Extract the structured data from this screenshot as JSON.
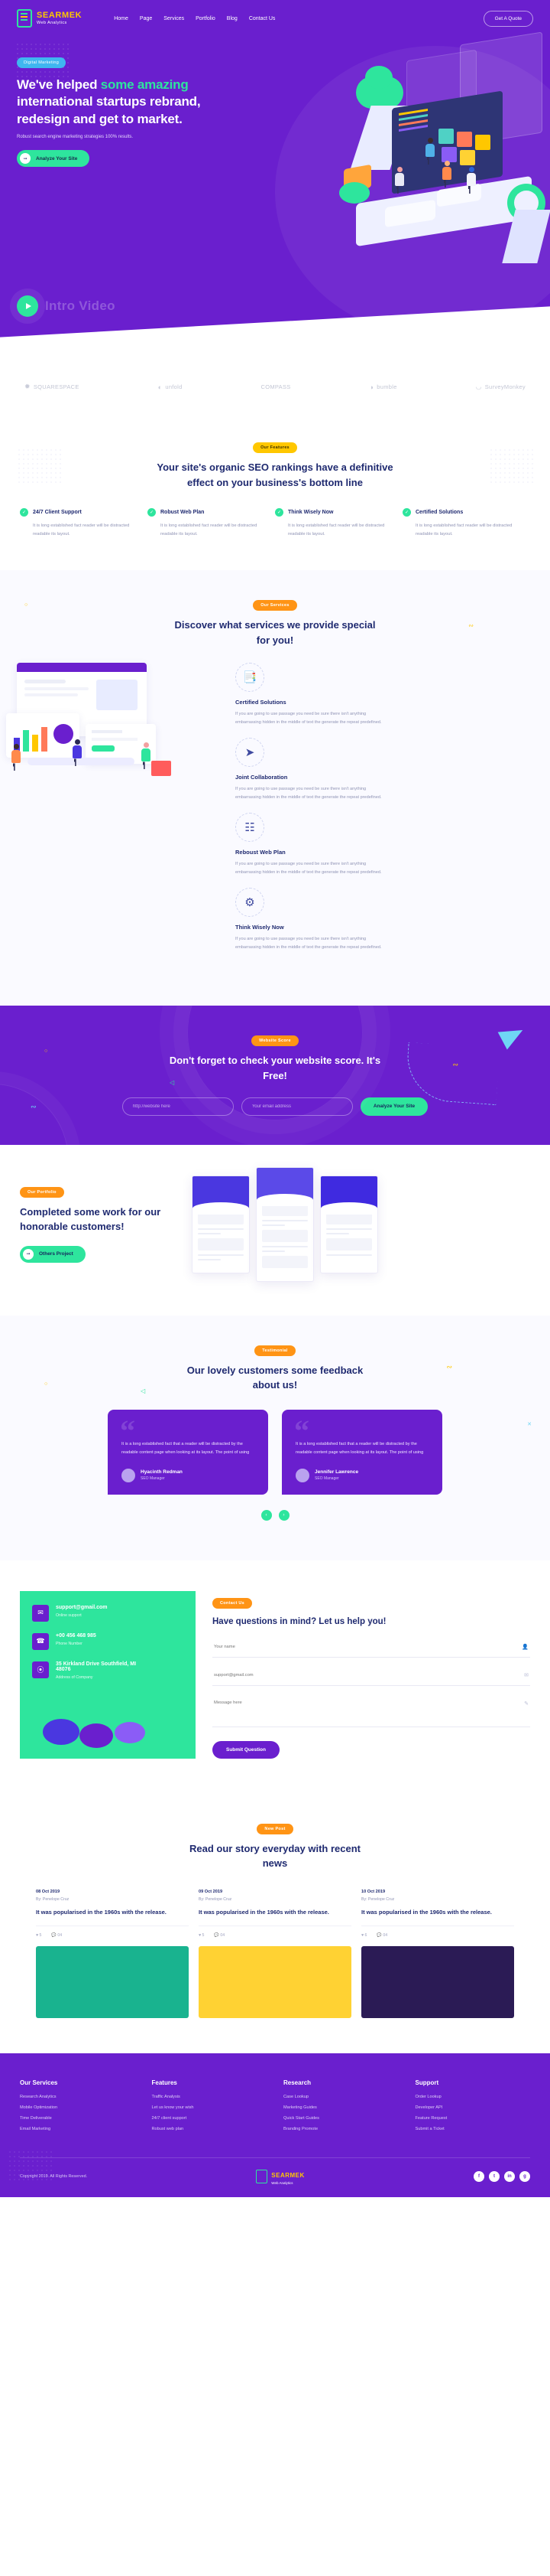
{
  "brand": {
    "name": "SEARMEK",
    "tagline": "Web Analytics"
  },
  "nav": {
    "items": [
      "Home",
      "Page",
      "Services",
      "Portfolio",
      "Blog",
      "Contact Us"
    ],
    "cta": "Get A Quote"
  },
  "hero": {
    "badge": "Digital Marketing",
    "title_part1": "We've helped ",
    "title_accent": "some amazing",
    "title_part2": "international startups rebrand, redesign and get to market.",
    "subtitle": "Robust search engine marketing strategies 100% results.",
    "button": "Analyze Your Site",
    "video_label": "Intro Video"
  },
  "logos": [
    {
      "name": "SQUARESPACE",
      "glyph": "✹"
    },
    {
      "name": "unfold",
      "glyph": "◠"
    },
    {
      "name": "COMPASS",
      "glyph": ""
    },
    {
      "name": "bumble",
      "glyph": "◑"
    },
    {
      "name": "SurveyMonkey",
      "glyph": "◡"
    }
  ],
  "features": {
    "badge": "Our Features",
    "title": "Your site's organic SEO rankings have a definitive effect on your business's bottom line",
    "items": [
      {
        "title": "24/7 Client Support",
        "desc": "It is long established fact reader will be distracted readable its layout."
      },
      {
        "title": "Robust Web Plan",
        "desc": "It is long established fact reader will be distracted readable its layout."
      },
      {
        "title": "Think Wisely Now",
        "desc": "It is long established fact reader will be distracted readable its layout."
      },
      {
        "title": "Certified Solutions",
        "desc": "It is long established fact reader will be distracted readable its layout."
      }
    ]
  },
  "services": {
    "badge": "Our Services",
    "title": "Discover what services we provide special for you!",
    "items": [
      {
        "title": "Certified Solutions",
        "icon": "certificate-icon",
        "glyph": "ὍC",
        "desc": "If you are going to use passage you need be sure there isn't anything embarrassing hidden in the middle of text the generate the repeat predefined."
      },
      {
        "title": "Joint Collaboration",
        "icon": "paper-plane-icon",
        "glyph": "➤",
        "desc": "If you are going to use passage you need be sure there isn't anything embarrassing hidden in the middle of text the generate the repeat predefined."
      },
      {
        "title": "Reboust Web Plan",
        "icon": "web-plan-icon",
        "glyph": "◳",
        "desc": "If you are going to use passage you need be sure there isn't anything embarrassing hidden in the middle of text the generate the repeat predefined."
      },
      {
        "title": "Think Wisely Now",
        "icon": "lightbulb-icon",
        "glyph": "⚙",
        "desc": "If you are going to use passage you need be sure there isn't anything embarrassing hidden in the middle of text the generate the repeat predefined."
      }
    ]
  },
  "cta": {
    "badge": "Website Score",
    "title": "Don't forget to check your website score. It's Free!",
    "website_placeholder": "http://website here",
    "email_placeholder": "Your email address",
    "button": "Analyze Your Site"
  },
  "portfolio": {
    "badge": "Our Portfolio",
    "title": "Completed some work for our honorable customers!",
    "button": "Others Project"
  },
  "testimonials": {
    "badge": "Testimonial",
    "title": "Our lovely customers some feedback about us!",
    "items": [
      {
        "quote": "It is a long established fact that a reader will be distracted by the readable content page when looking at its layout. The point of using",
        "name": "Hyacinth Redman",
        "role": "SEO Manager"
      },
      {
        "quote": "It is a long established fact that a reader will be distracted by the readable content page when looking at its layout. The point of using",
        "name": "Jennifer Lawrence",
        "role": "SEO Manager"
      }
    ],
    "prev": "‹",
    "next": "›"
  },
  "contact": {
    "badge": "Contact Us",
    "title": "Have questions in mind? Let us help you!",
    "info": [
      {
        "icon": "envelope-icon",
        "glyph": "✉",
        "title": "support@gmail.com",
        "sub": "Online support"
      },
      {
        "icon": "phone-icon",
        "glyph": "☎",
        "title": "+00 456 468 985",
        "sub": "Phone Number"
      },
      {
        "icon": "location-icon",
        "glyph": "⦿",
        "title": "35 Kirkland Drive Southfield, MI 48076",
        "sub": "Address of Company"
      }
    ],
    "form": {
      "name_placeholder": "Your name",
      "email_placeholder": "support@gmail.com",
      "message_placeholder": "Message here",
      "submit": "Submit Question"
    }
  },
  "blog": {
    "badge": "New Post",
    "title": "Read our story everyday with recent news",
    "posts": [
      {
        "date": "08 Oct 2019",
        "author": "By: Penelope Cruz",
        "title": "It was popularised in the 1960s with the release.",
        "likes": "5",
        "comments": "04"
      },
      {
        "date": "09 Oct 2019",
        "author": "By: Penelope Cruz",
        "title": "It was popularised in the 1960s with the release.",
        "likes": "5",
        "comments": "04"
      },
      {
        "date": "10 Oct 2019",
        "author": "By: Penelope Cruz",
        "title": "It was popularised in the 1960s with the release.",
        "likes": "6",
        "comments": "04"
      }
    ]
  },
  "footer": {
    "columns": [
      {
        "heading": "Our Services",
        "links": [
          "Research Analytics",
          "Mobile Optimization",
          "Time Deliverable",
          "Email Marketing"
        ]
      },
      {
        "heading": "Features",
        "links": [
          "Traffic Analysis",
          "Let us know your wish",
          "24/7 client support",
          "Robust web plan"
        ]
      },
      {
        "heading": "Research",
        "links": [
          "Case Lookup",
          "Marketing Guides",
          "Quick Start Guides",
          "Branding Promote"
        ]
      },
      {
        "heading": "Support",
        "links": [
          "Order Lookup",
          "Developer API",
          "Feature Request",
          "Submit a Ticket"
        ]
      }
    ],
    "copyright": "Copyright 2019. All Rights Reserved.",
    "brand": {
      "name": "SEARMEK",
      "tagline": "Web Analytics"
    },
    "socials": [
      "f",
      "t",
      "in",
      "g"
    ]
  },
  "colors": {
    "purple": "#6a1fce",
    "green": "#2ee59d",
    "orange": "#ff9415",
    "yellow": "#ffc700",
    "navy": "#1f2a70"
  }
}
